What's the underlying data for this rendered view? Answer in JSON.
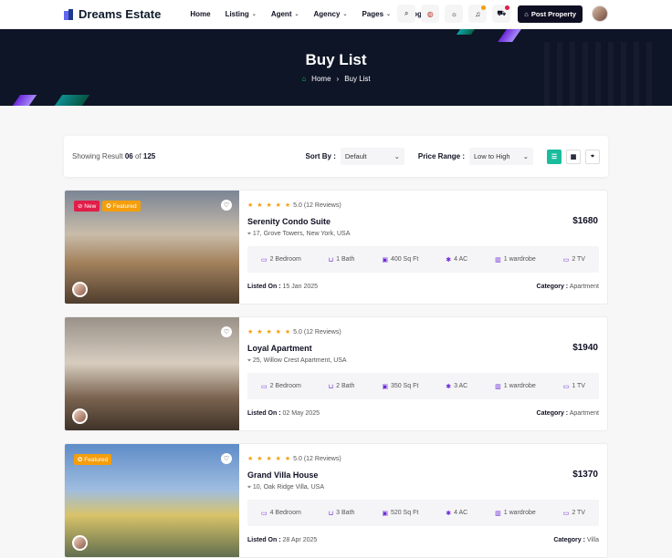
{
  "header": {
    "logo": "Dreams Estate",
    "nav": [
      {
        "label": "Home",
        "dropdown": false
      },
      {
        "label": "Listing",
        "dropdown": true
      },
      {
        "label": "Agent",
        "dropdown": true
      },
      {
        "label": "Agency",
        "dropdown": true
      },
      {
        "label": "Pages",
        "dropdown": true
      },
      {
        "label": "Blog",
        "dropdown": true
      }
    ],
    "post_button": "Post Property",
    "icons": [
      "search-icon",
      "globe-icon",
      "sun-icon",
      "bell-icon",
      "cart-icon"
    ],
    "accent_colors": {
      "bell_badge": "#f59e0b",
      "cart_badge": "#e11d48"
    }
  },
  "banner": {
    "title": "Buy List",
    "crumb_home": "Home",
    "crumb_current": "Buy List"
  },
  "filter": {
    "showing_prefix": "Showing Result",
    "showing_count": "06",
    "of": "of",
    "total": "125",
    "sort_label": "Sort By :",
    "sort_value": "Default",
    "price_label": "Price Range :",
    "price_value": "Low to High",
    "views": [
      "list-view-icon",
      "grid-view-icon",
      "map-view-icon"
    ],
    "active_color": "#1abc9c"
  },
  "listings": [
    {
      "tags": [
        "New",
        "Featured"
      ],
      "stars": "★ ★ ★ ★ ★",
      "rating": "5.0 (12 Reviews)",
      "title": "Serenity Condo Suite",
      "address": "17, Grove Towers, New York, USA",
      "price": "$1680",
      "features": [
        "2 Bedroom",
        "1 Bath",
        "400 Sq Ft",
        "4 AC",
        "1 wardrobe",
        "2 TV"
      ],
      "listed_label": "Listed On :",
      "listed_date": "15 Jan 2025",
      "category_label": "Category :",
      "category": "Apartment"
    },
    {
      "tags": [],
      "stars": "★ ★ ★ ★ ★",
      "rating": "5.0 (12 Reviews)",
      "title": "Loyal Apartment",
      "address": "25, Willow Crest Apartment, USA",
      "price": "$1940",
      "features": [
        "2 Bedroom",
        "2 Bath",
        "350 Sq Ft",
        "3 AC",
        "1 wardrobe",
        "1 TV"
      ],
      "listed_label": "Listed On :",
      "listed_date": "02 May 2025",
      "category_label": "Category :",
      "category": "Apartment"
    },
    {
      "tags": [
        "Featured"
      ],
      "stars": "★ ★ ★ ★ ★",
      "rating": "5.0 (12 Reviews)",
      "title": "Grand Villa House",
      "address": "10, Oak Ridge Villa, USA",
      "price": "$1370",
      "features": [
        "4 Bedroom",
        "3 Bath",
        "520 Sq Ft",
        "4 AC",
        "1 wardrobe",
        "2 TV"
      ],
      "listed_label": "Listed On :",
      "listed_date": "28 Apr 2025",
      "category_label": "Category :",
      "category": "Villa"
    }
  ]
}
